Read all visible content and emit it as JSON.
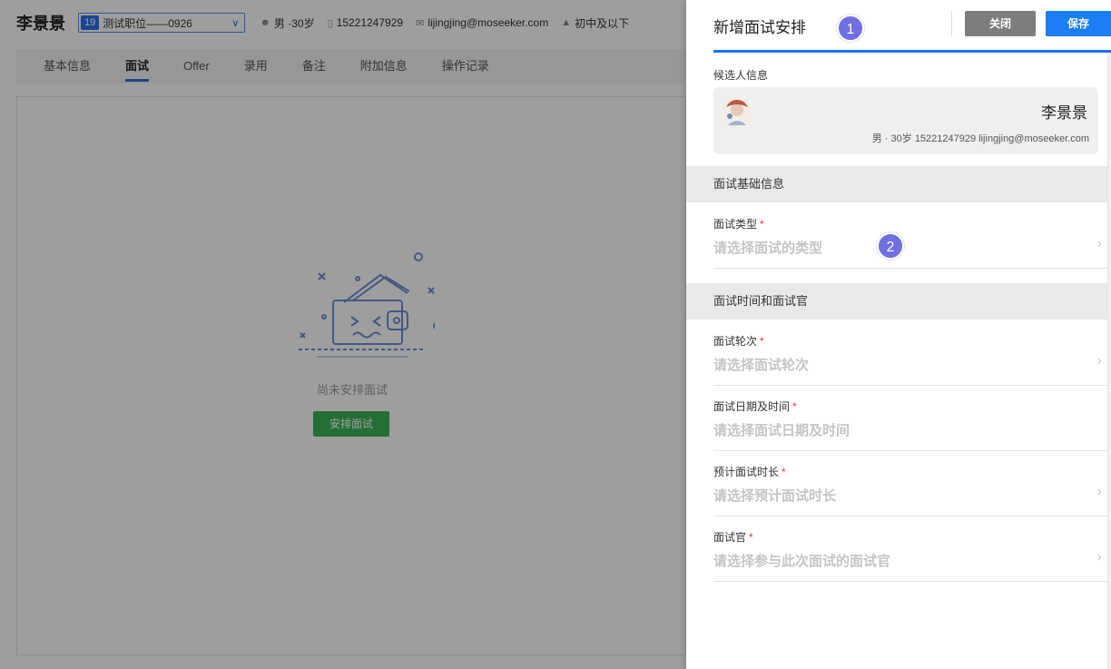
{
  "candidate": {
    "name": "李景景",
    "job_badge": "19",
    "job": "测试职位——0926",
    "gender_age": "男 ·30岁",
    "phone": "15221247929",
    "email": "lijingjing@moseeker.com",
    "education": "初中及以下"
  },
  "tabs": [
    {
      "label": "基本信息",
      "active": false
    },
    {
      "label": "面试",
      "active": true
    },
    {
      "label": "Offer",
      "active": false
    },
    {
      "label": "录用",
      "active": false
    },
    {
      "label": "备注",
      "active": false
    },
    {
      "label": "附加信息",
      "active": false
    },
    {
      "label": "操作记录",
      "active": false
    }
  ],
  "empty_state": {
    "text": "尚未安排面试",
    "button": "安排面试"
  },
  "drawer": {
    "title": "新增面试安排",
    "close_label": "关闭",
    "save_label": "保存",
    "step_badges": [
      "1",
      "2"
    ],
    "candidate_section_label": "候选人信息",
    "candidate_card": {
      "name": "李景景",
      "info": "男 · 30岁   15221247929   lijingjing@moseeker.com"
    },
    "group_basic": "面试基础信息",
    "group_time": "面试时间和面试官",
    "fields": [
      {
        "label": "面试类型",
        "required": "*",
        "placeholder": "请选择面试的类型",
        "chevron": true
      },
      {
        "label": "面试轮次",
        "required": "*",
        "placeholder": "请选择面试轮次",
        "chevron": true
      },
      {
        "label": "面试日期及时间",
        "required": "*",
        "placeholder": "请选择面试日期及时间",
        "chevron": false
      },
      {
        "label": "预计面试时长",
        "required": "*",
        "placeholder": "请选择预计面试时长",
        "chevron": true
      },
      {
        "label": "面试官",
        "required": "*",
        "placeholder": "请选择参与此次面试的面试官",
        "chevron": true
      }
    ]
  },
  "colors": {
    "primary": "#1a7ff5",
    "success": "#3cb35a",
    "badge": "#6f6fe0",
    "required": "#e33333"
  }
}
